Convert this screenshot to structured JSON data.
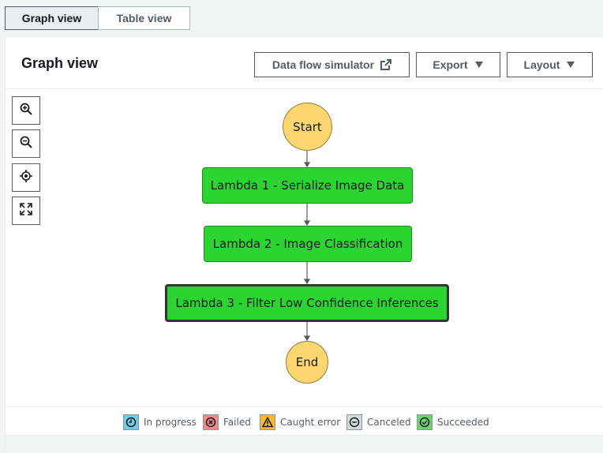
{
  "tabs": {
    "graph_view": "Graph view",
    "table_view": "Table view"
  },
  "panel": {
    "title": "Graph view",
    "data_flow_simulator": "Data flow simulator",
    "export": "Export",
    "layout": "Layout"
  },
  "controls": [
    "zoom-in-icon",
    "zoom-out-icon",
    "center-icon",
    "fit-icon"
  ],
  "graph": {
    "start": "Start",
    "end": "End",
    "steps": [
      "Lambda 1 - Serialize Image Data",
      "Lambda 2 - Image Classification",
      "Lambda 3 - Filter Low Confidence Inferences"
    ],
    "selected_step": 3
  },
  "legend": {
    "in_progress": "In progress",
    "failed": "Failed",
    "caught_error": "Caught error",
    "canceled": "Canceled",
    "succeeded": "Succeeded"
  },
  "colors": {
    "step_success": "#2bd430",
    "start_end": "#fcd670",
    "in_progress": "#71cde6",
    "failed": "#f08a8a",
    "caught_error": "#f8b830",
    "canceled": "#d5dbdb",
    "succeeded": "#6fd46f"
  }
}
